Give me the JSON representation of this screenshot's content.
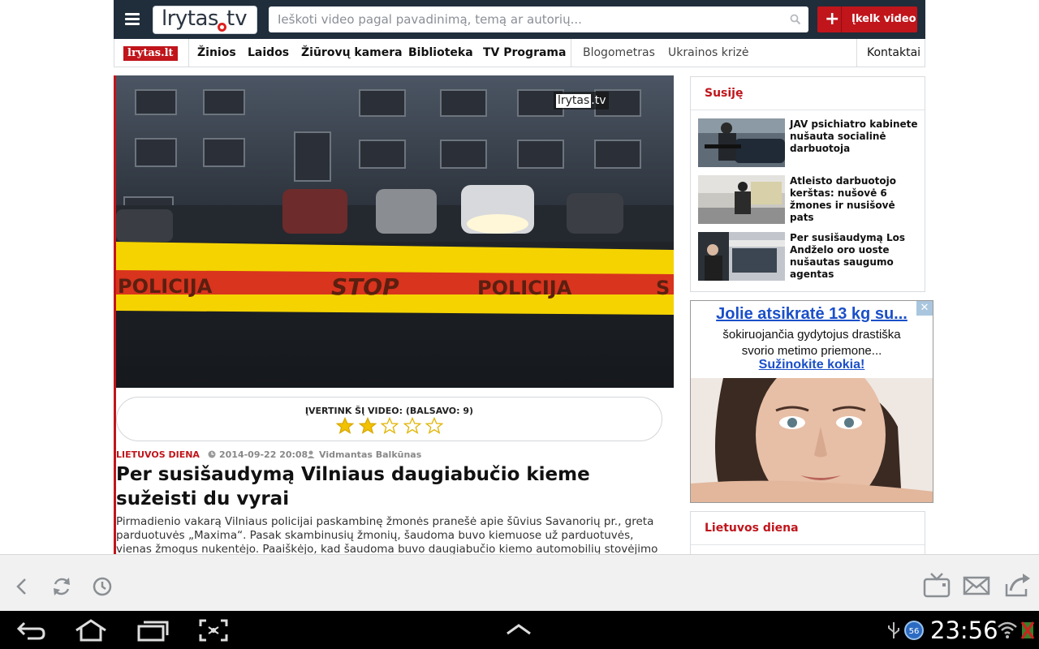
{
  "header": {
    "logo_main": "lrytas",
    "logo_tv": "tv",
    "search_placeholder": "Ieškoti video pagal pavadinimą, temą ar autorių...",
    "upload_plus": "+",
    "upload_label": "Įkelk video"
  },
  "nav": {
    "logo": "lrytas.lt",
    "items": [
      "Žinios",
      "Laidos",
      "Žiūrovų kamera",
      "Biblioteka",
      "TV Programa"
    ],
    "secondary": [
      "Blogometras",
      "Ukrainos krizė"
    ],
    "contact": "Kontaktai"
  },
  "video": {
    "watermark_a": "lrytas",
    "watermark_b": ".tv",
    "tape_text_1": "POLICIJA",
    "tape_text_2": "STOP",
    "tape_text_3": "POLICIJA",
    "tape_text_4": "S"
  },
  "rating": {
    "label": "ĮVERTINK ŠĮ VIDEO: (BALSAVO: 9)",
    "value": 2,
    "max": 5
  },
  "article": {
    "category": "LIETUVOS DIENA",
    "date": "2014-09-22 20:08",
    "author": "Vidmantas Balkūnas",
    "title": "Per susišaudymą Vilniaus daugiabučio kieme sužeisti du vyrai",
    "text": "Pirmadienio vakarą Vilniaus policijai paskambinę žmonės pranešė apie šūvius Savanorių pr., greta parduotuvės „Maxima“. Pasak skambinusių žmonių, šaudoma buvo kiemuose už parduotuvės, vienas žmogus nukentėjo. Paaiškėjo, kad šaudoma buvo daugiabučio kiemo automobilių stovėjimo aikštelėje."
  },
  "sidebar": {
    "related_title": "Susiję",
    "related": [
      {
        "title": "JAV psichiatro kabinete nušauta socialinė darbuotoja"
      },
      {
        "title": "Atleisto darbuotojo kerštas: nušovė 6 žmones ir nusišovė pats"
      },
      {
        "title": "Per susišaudymą Los Andželo oro uoste nušautas saugumo agentas"
      }
    ],
    "ad": {
      "close": "✕",
      "headline": "Jolie atsikratė 13 kg su...",
      "body_line1": "šokiruojančia gydytojus drastiška",
      "body_line2": "svorio metimo priemone...",
      "link": "Sužinokite kokia!"
    },
    "section_title": "Lietuvos diena"
  },
  "status_bar": {
    "clock": "23:56",
    "notification_badge": "56"
  },
  "colors": {
    "brand_red": "#c0151b",
    "header_bg": "#202d3b",
    "ad_link": "#1a4fc9"
  }
}
